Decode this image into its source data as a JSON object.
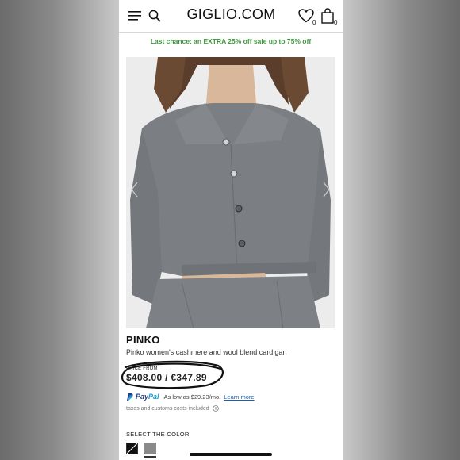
{
  "header": {
    "logo": "GIGLIO.COM",
    "wishlist_count": "0",
    "bag_count": "0"
  },
  "promo": {
    "text": "Last chance: an EXTRA 25% off sale up to 75% off",
    "color": "#3a9a3a"
  },
  "product": {
    "brand": "PINKO",
    "name": "Pinko women's cashmere and wool blend cardigan",
    "price_label": "PRICE FROM",
    "price": "$408.00 / €347.89"
  },
  "paypal": {
    "brand_pay": "Pay",
    "brand_pal": "Pal",
    "text": "As low as $29.23/mo.",
    "link": "Learn more"
  },
  "taxes": {
    "text": "taxes and customs costs included"
  },
  "colors": {
    "label": "SELECT THE COLOR",
    "options": [
      "black",
      "grey"
    ]
  },
  "icons": [
    "menu-icon",
    "search-icon",
    "heart-icon",
    "bag-icon",
    "chevron-left-icon",
    "chevron-right-icon",
    "paypal-logo",
    "info-icon"
  ]
}
